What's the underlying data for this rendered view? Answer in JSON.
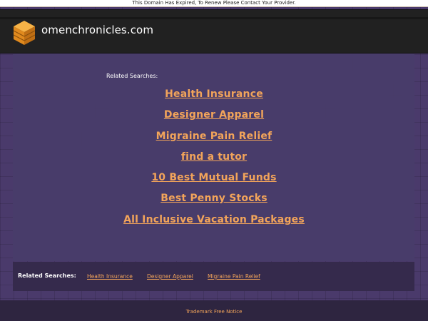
{
  "notice": {
    "text": "This Domain Has Expired, To Renew Please Contact Your Provider."
  },
  "header": {
    "domain": "omenchronicles.com",
    "logo_icon": "stacked-cube-icon",
    "accent_color": "#f5a23a"
  },
  "main": {
    "related_label": "Related Searches:",
    "links": [
      "Health Insurance",
      "Designer Apparel",
      "Migraine Pain Relief",
      "find a tutor",
      "10 Best Mutual Funds",
      "Best Penny Stocks",
      "All Inclusive Vacation Packages"
    ],
    "link_color": "#f2a45a"
  },
  "bottom": {
    "label": "Related Searches:",
    "links": [
      "Health Insurance",
      "Designer Apparel",
      "Migraine Pain Relief"
    ]
  },
  "footer": {
    "notice": "Trademark Free Notice"
  }
}
